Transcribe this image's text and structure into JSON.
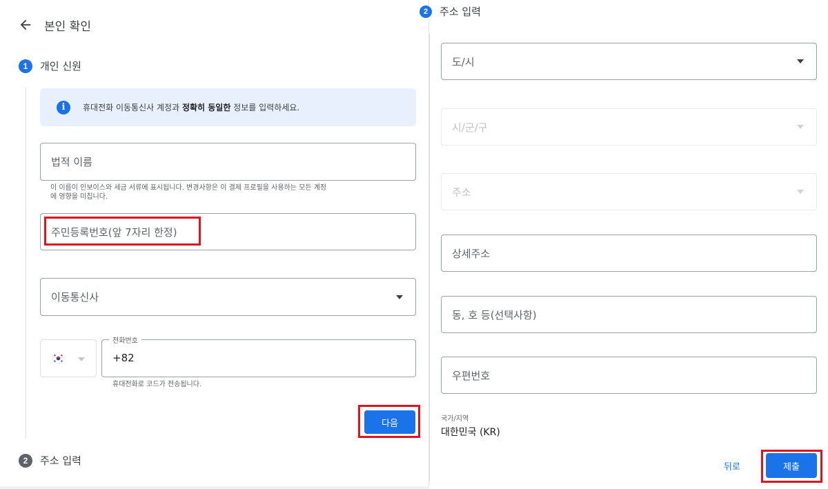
{
  "header": {
    "title": "본인 확인"
  },
  "step1": {
    "number": "1",
    "label": "개인 신원"
  },
  "step2": {
    "number": "2",
    "label": "주소 입력"
  },
  "info": {
    "text_before": "휴대전화 이동통신사 계정과 ",
    "text_bold": "정확히 동일한",
    "text_after": " 정보를 입력하세요."
  },
  "personal": {
    "name_placeholder": "법적 이름",
    "name_helper_line1": "이 이름이 인보이스와 세금 서류에 표시됩니다. 변경사항은 이 결제 프로필을 사용하는 모든 계정",
    "name_helper_line2": "에 영향을 미칩니다.",
    "rrn_placeholder": "주민등록번호(앞 7자리 한정)",
    "carrier_placeholder": "이동통신사",
    "phone_label": "전화번호",
    "phone_value": "+82",
    "phone_helper": "휴대전화로 코드가 전송됩니다.",
    "next_button": "다음"
  },
  "address": {
    "step_label": "주소 입력",
    "city": "도/시",
    "district": "시/군/구",
    "street": "주소",
    "detail": "상세주소",
    "unit": "동, 호 등(선택사항)",
    "postal": "우편번호",
    "country_label": "국가/지역",
    "country_value": "대한민국 (KR)",
    "back_button": "뒤로",
    "submit_button": "제출"
  },
  "colors": {
    "accent": "#1a73e8",
    "highlight": "#e0141f",
    "info_bg": "#e8f0fe"
  }
}
